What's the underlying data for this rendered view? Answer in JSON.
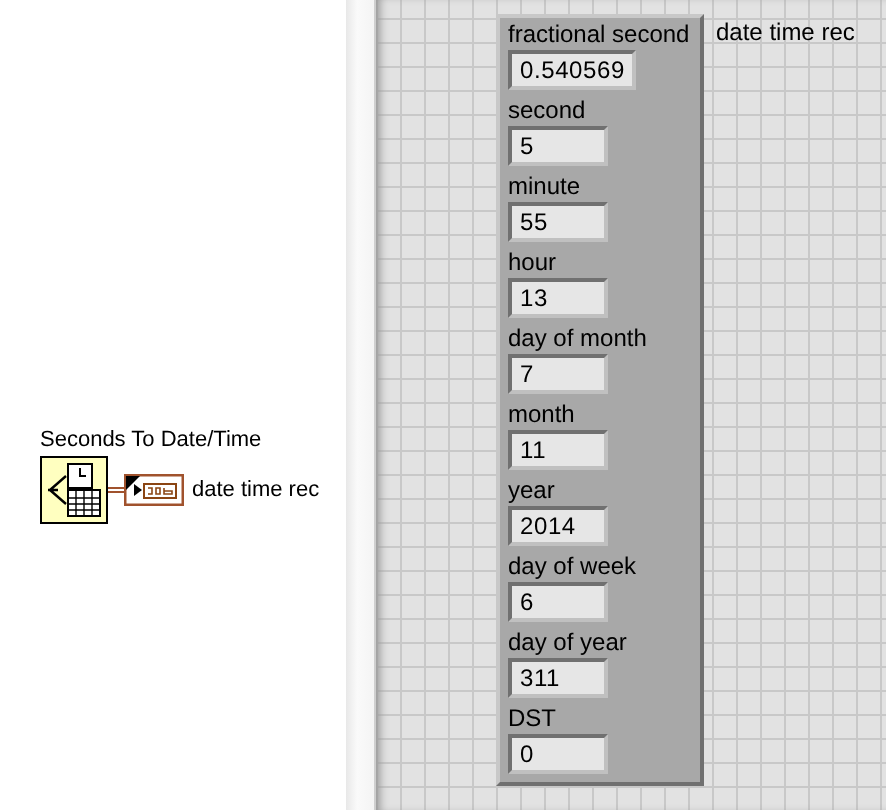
{
  "block_diagram": {
    "function_label": "Seconds To Date/Time",
    "indicator_label": "date time rec"
  },
  "front_panel": {
    "cluster": {
      "label": "date time rec",
      "fields": [
        {
          "label": "fractional second",
          "value": "0.540569"
        },
        {
          "label": "second",
          "value": "5"
        },
        {
          "label": "minute",
          "value": "55"
        },
        {
          "label": "hour",
          "value": "13"
        },
        {
          "label": "day of month",
          "value": "7"
        },
        {
          "label": "month",
          "value": "11"
        },
        {
          "label": "year",
          "value": "2014"
        },
        {
          "label": "day of week",
          "value": "6"
        },
        {
          "label": "day of year",
          "value": "311"
        },
        {
          "label": "DST",
          "value": "0"
        }
      ]
    }
  }
}
